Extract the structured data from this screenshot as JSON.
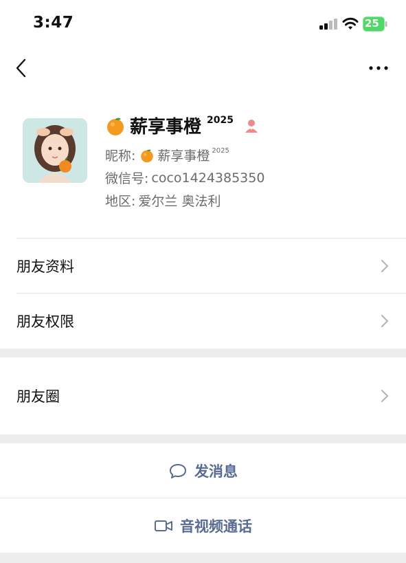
{
  "status_bar": {
    "time": "3:47",
    "battery": "25"
  },
  "profile": {
    "display_name": "薪享事橙",
    "display_name_sup": "2025",
    "nickname_label": "昵称:",
    "nickname": "薪享事橙",
    "nickname_sup": "2025",
    "wechat_id_label": "微信号:",
    "wechat_id": "coco1424385350",
    "region_label": "地区:",
    "region": "爱尔兰 奥法利"
  },
  "menu": {
    "items": [
      {
        "label": "朋友资料"
      },
      {
        "label": "朋友权限"
      },
      {
        "label": "朋友圈"
      }
    ]
  },
  "actions": {
    "message": "发消息",
    "call": "音视频通话"
  },
  "colors": {
    "link_blue": "#576b95",
    "gender_female": "#f08a8a",
    "battery_green": "#4cd964",
    "background": "#ededed"
  },
  "icons": [
    "back-icon",
    "more-icon",
    "orange-emoji-icon",
    "female-icon",
    "chevron-right-icon",
    "chat-bubble-icon",
    "video-camera-icon"
  ]
}
